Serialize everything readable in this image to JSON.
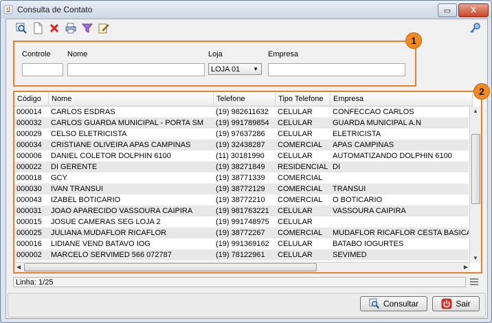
{
  "window": {
    "title": "Consulta de Contato",
    "min_label": "▭",
    "close_label": "X"
  },
  "toolbar": {
    "icons": [
      "search-icon",
      "new-document-icon",
      "delete-icon",
      "print-icon",
      "filter-icon",
      "edit-icon"
    ],
    "right_icon": "key-icon"
  },
  "filter": {
    "controle_label": "Controle",
    "nome_label": "Nome",
    "loja_label": "Loja",
    "loja_value": "LOJA 01",
    "empresa_label": "Empresa",
    "badge": "1"
  },
  "grid": {
    "badge": "2",
    "columns": [
      "Código",
      "Nome",
      "Telefone",
      "Tipo Telefone",
      "Empresa"
    ],
    "rows": [
      [
        "000014",
        "CARLOS ESDRAS",
        "(19) 982611632",
        "CELULAR",
        "CONFECCAO CARLOS"
      ],
      [
        "000032",
        "CARLOS GUARDA MUNICIPAL - PORTA SM",
        "(19) 991789854",
        "CELULAR",
        "GUARDA MUNICIPAL A.N"
      ],
      [
        "000029",
        "CELSO ELETRICISTA",
        "(19) 97637286",
        "CELULAR",
        "ELETRICISTA"
      ],
      [
        "000034",
        "CRISTIANE OLIVEIRA APAS CAMPINAS",
        "(19) 32438287",
        "COMERCIAL",
        "APAS CAMPINAS"
      ],
      [
        "000006",
        "DANIEL COLETOR DOLPHIN 6100",
        "(11) 30181990",
        "CELULAR",
        "AUTOMATIZANDO DOLPHIN 6100"
      ],
      [
        "000022",
        "DI GERENTE",
        "(19) 38271849",
        "RESIDENCIAL",
        "DI"
      ],
      [
        "000018",
        "GCY",
        "(19) 38771339",
        "COMERCIAL",
        ""
      ],
      [
        "000030",
        "IVAN TRANSUI",
        "(19) 38772129",
        "COMERCIAL",
        "TRANSUI"
      ],
      [
        "000043",
        "IZABEL BOTICARIO",
        "(19) 38772210",
        "COMERCIAL",
        "O BOTICARIO"
      ],
      [
        "000031",
        "JOAO APARECIDO VASSOURA CAIPIRA",
        "(19) 981763221",
        "CELULAR",
        "VASSOURA CAIPIRA"
      ],
      [
        "000015",
        "JOSUE CAMERAS SEG LOJA 2",
        "(19) 991748975",
        "CELULAR",
        ""
      ],
      [
        "000025",
        "JULIANA MUDAFLOR RICAFLOR",
        "(19) 38772267",
        "COMERCIAL",
        "MUDAFLOR RICAFLOR CESTA BASICA"
      ],
      [
        "000016",
        "LIDIANE VEND BATAVO IOG",
        "(19) 991369162",
        "CELULAR",
        "BATABO IOGURTES"
      ],
      [
        "000002",
        "MARCELO SERVIMED 566 072787",
        "(19) 78122961",
        "CELULAR",
        "SEVIMED"
      ]
    ]
  },
  "status": {
    "line_text": "Linha: 1/25"
  },
  "footer": {
    "consultar_label": "Consultar",
    "sair_label": "Sair"
  },
  "colors": {
    "highlight_border": "#e8802b",
    "badge": "#f08a24"
  }
}
